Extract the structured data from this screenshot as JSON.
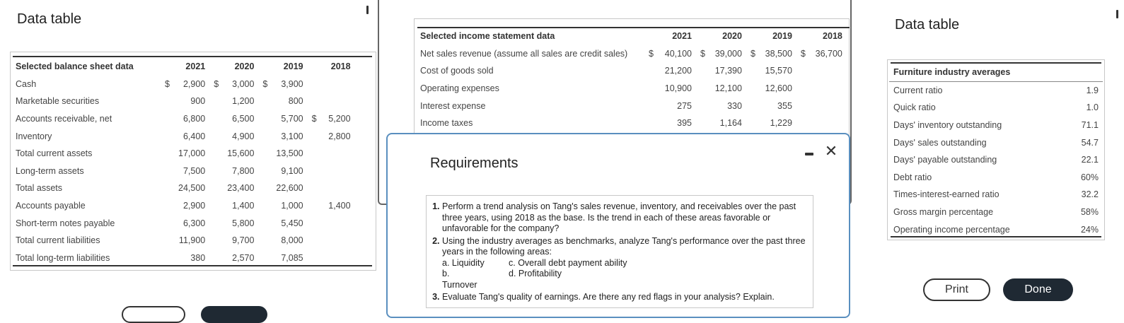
{
  "left_panel": {
    "title": "Data table",
    "table": {
      "header": [
        "Selected balance sheet data",
        "2021",
        "2020",
        "2019",
        "2018"
      ],
      "rows": [
        {
          "label": "Cash",
          "d1": "$",
          "v1": "2,900",
          "d2": "$",
          "v2": "3,000",
          "d3": "$",
          "v3": "3,900",
          "d4": "",
          "v4": ""
        },
        {
          "label": "Marketable securities",
          "d1": "",
          "v1": "900",
          "d2": "",
          "v2": "1,200",
          "d3": "",
          "v3": "800",
          "d4": "",
          "v4": ""
        },
        {
          "label": "Accounts receivable, net",
          "d1": "",
          "v1": "6,800",
          "d2": "",
          "v2": "6,500",
          "d3": "",
          "v3": "5,700",
          "d4": "$",
          "v4": "5,200"
        },
        {
          "label": "Inventory",
          "d1": "",
          "v1": "6,400",
          "d2": "",
          "v2": "4,900",
          "d3": "",
          "v3": "3,100",
          "d4": "",
          "v4": "2,800"
        },
        {
          "label": "Total current assets",
          "d1": "",
          "v1": "17,000",
          "d2": "",
          "v2": "15,600",
          "d3": "",
          "v3": "13,500",
          "d4": "",
          "v4": ""
        },
        {
          "label": "Long-term assets",
          "d1": "",
          "v1": "7,500",
          "d2": "",
          "v2": "7,800",
          "d3": "",
          "v3": "9,100",
          "d4": "",
          "v4": ""
        },
        {
          "label": "Total assets",
          "d1": "",
          "v1": "24,500",
          "d2": "",
          "v2": "23,400",
          "d3": "",
          "v3": "22,600",
          "d4": "",
          "v4": ""
        },
        {
          "label": "Accounts payable",
          "d1": "",
          "v1": "2,900",
          "d2": "",
          "v2": "1,400",
          "d3": "",
          "v3": "1,000",
          "d4": "",
          "v4": "1,400"
        },
        {
          "label": "Short-term notes payable",
          "d1": "",
          "v1": "6,300",
          "d2": "",
          "v2": "5,800",
          "d3": "",
          "v3": "5,450",
          "d4": "",
          "v4": ""
        },
        {
          "label": "Total current liabilities",
          "d1": "",
          "v1": "11,900",
          "d2": "",
          "v2": "9,700",
          "d3": "",
          "v3": "8,000",
          "d4": "",
          "v4": ""
        },
        {
          "label": "Total long-term liabilities",
          "d1": "",
          "v1": "380",
          "d2": "",
          "v2": "2,570",
          "d3": "",
          "v3": "7,085",
          "d4": "",
          "v4": ""
        }
      ]
    }
  },
  "middle_panel": {
    "table": {
      "header": [
        "Selected income statement data",
        "2021",
        "2020",
        "2019",
        "2018"
      ],
      "rows": [
        {
          "label": "Net sales revenue (assume all sales are credit sales)",
          "d1": "$",
          "v1": "40,100",
          "d2": "$",
          "v2": "39,000",
          "d3": "$",
          "v3": "38,500",
          "d4": "$",
          "v4": "36,700"
        },
        {
          "label": "Cost of goods sold",
          "d1": "",
          "v1": "21,200",
          "d2": "",
          "v2": "17,390",
          "d3": "",
          "v3": "15,570",
          "d4": "",
          "v4": ""
        },
        {
          "label": "Operating expenses",
          "d1": "",
          "v1": "10,900",
          "d2": "",
          "v2": "12,100",
          "d3": "",
          "v3": "12,600",
          "d4": "",
          "v4": ""
        },
        {
          "label": "Interest expense",
          "d1": "",
          "v1": "275",
          "d2": "",
          "v2": "330",
          "d3": "",
          "v3": "355",
          "d4": "",
          "v4": ""
        },
        {
          "label": "Income taxes",
          "d1": "",
          "v1": "395",
          "d2": "",
          "v2": "1,164",
          "d3": "",
          "v3": "1,229",
          "d4": "",
          "v4": ""
        }
      ]
    }
  },
  "requirements": {
    "title": "Requirements",
    "minimize_icon": "minimize-icon",
    "close_icon": "close-icon",
    "items": [
      "Perform a trend analysis on Tang's sales revenue, inventory, and receivables over the past three years, using 2018 as the base. Is the trend in each of these areas favorable or unfavorable for the company?",
      "Using the industry averages as benchmarks, analyze Tang's performance over the past three years in the following areas:",
      "Evaluate Tang's quality of earnings. Are there any red flags in your analysis? Explain."
    ],
    "subitems": {
      "a": "a. Liquidity",
      "b": "b. Turnover",
      "c": "c. Overall debt payment ability",
      "d": "d. Profitability"
    }
  },
  "right_panel": {
    "title": "Data table",
    "table": {
      "header": "Furniture industry averages",
      "rows": [
        {
          "label": "Current ratio",
          "value": "1.9"
        },
        {
          "label": "Quick ratio",
          "value": "1.0"
        },
        {
          "label": "Days' inventory outstanding",
          "value": "71.1"
        },
        {
          "label": "Days' sales outstanding",
          "value": "54.7"
        },
        {
          "label": "Days' payable outstanding",
          "value": "22.1"
        },
        {
          "label": "Debt ratio",
          "value": "60%"
        },
        {
          "label": "Times-interest-earned ratio",
          "value": "32.2"
        },
        {
          "label": "Gross margin percentage",
          "value": "58%"
        },
        {
          "label": "Operating income percentage",
          "value": "24%"
        }
      ]
    },
    "print_label": "Print",
    "done_label": "Done"
  },
  "colors": {
    "modal_border": "#5a8fbf",
    "done_button": "#1f2933",
    "rule": "#333333"
  }
}
